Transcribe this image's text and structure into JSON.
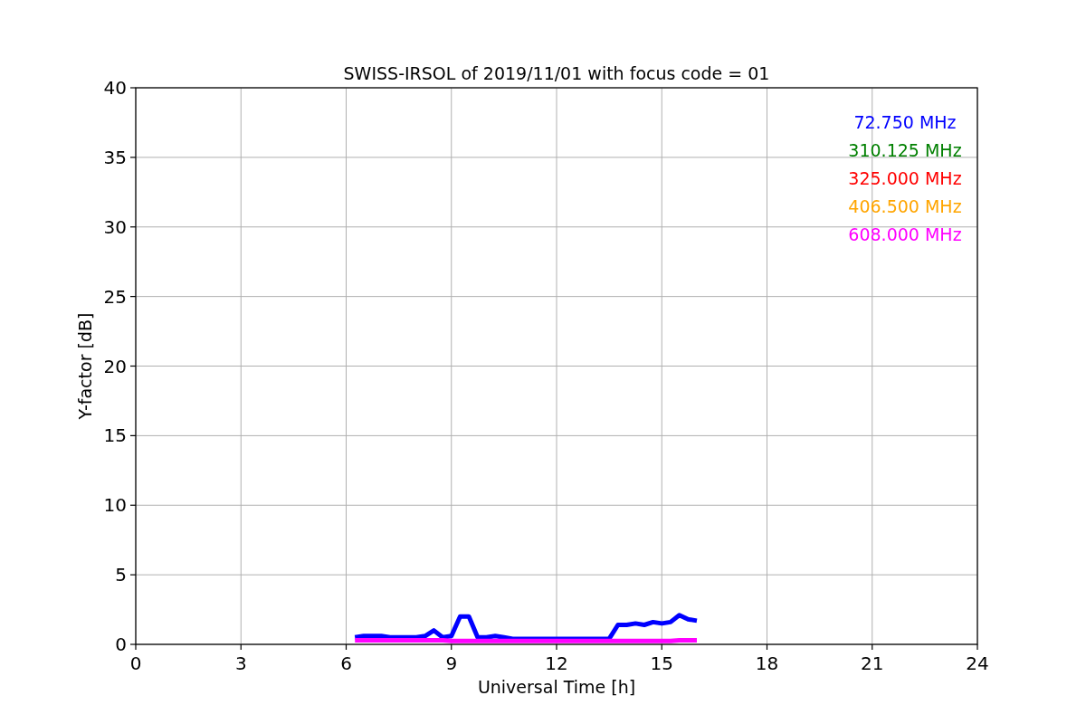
{
  "figure": {
    "chart_data": {
      "type": "line",
      "title": "SWISS-IRSOL of 2019/11/01 with focus code = 01",
      "xlabel": "Universal Time [h]",
      "ylabel": "Y-factor [dB]",
      "x": [
        6.25,
        6.5,
        6.75,
        7,
        7.25,
        7.5,
        7.75,
        8,
        8.25,
        8.5,
        8.75,
        9,
        9.25,
        9.5,
        9.75,
        10,
        10.25,
        10.5,
        10.75,
        11,
        11.25,
        11.5,
        11.75,
        12,
        12.25,
        12.5,
        12.75,
        13,
        13.25,
        13.5,
        13.75,
        14,
        14.25,
        14.5,
        14.75,
        15,
        15.25,
        15.5,
        15.75,
        16
      ],
      "series": [
        {
          "name": "72.750 MHz",
          "color": "#0000ff",
          "values": [
            0.5,
            0.6,
            0.6,
            0.6,
            0.5,
            0.5,
            0.5,
            0.5,
            0.6,
            1.0,
            0.5,
            0.6,
            2.0,
            2.0,
            0.5,
            0.5,
            0.6,
            0.5,
            0.4,
            0.4,
            0.4,
            0.4,
            0.4,
            0.4,
            0.4,
            0.4,
            0.4,
            0.4,
            0.4,
            0.4,
            1.4,
            1.4,
            1.5,
            1.4,
            1.6,
            1.5,
            1.6,
            2.1,
            1.8,
            1.7
          ]
        },
        {
          "name": "310.125 MHz",
          "color": "#008000",
          "values": [
            null,
            null,
            null,
            null,
            null,
            null,
            null,
            null,
            null,
            null,
            null,
            null,
            null,
            null,
            null,
            null,
            null,
            null,
            null,
            null,
            null,
            null,
            null,
            null,
            null,
            null,
            null,
            null,
            null,
            null,
            null,
            null,
            null,
            null,
            null,
            null,
            null,
            null,
            null,
            null
          ]
        },
        {
          "name": "325.000 MHz",
          "color": "#ff0000",
          "values": [
            null,
            null,
            null,
            null,
            null,
            null,
            null,
            null,
            null,
            null,
            null,
            null,
            null,
            null,
            null,
            null,
            null,
            null,
            null,
            null,
            null,
            null,
            null,
            null,
            null,
            null,
            null,
            null,
            null,
            null,
            null,
            null,
            null,
            null,
            null,
            null,
            null,
            null,
            null,
            null
          ]
        },
        {
          "name": "406.500 MHz",
          "color": "#ffa500",
          "values": [
            null,
            null,
            null,
            null,
            null,
            null,
            null,
            null,
            null,
            null,
            null,
            null,
            null,
            null,
            null,
            null,
            null,
            null,
            null,
            null,
            null,
            null,
            null,
            null,
            null,
            null,
            null,
            null,
            null,
            null,
            null,
            null,
            null,
            null,
            null,
            null,
            null,
            null,
            null,
            null
          ]
        },
        {
          "name": "608.000 MHz",
          "color": "#ff00ff",
          "values": [
            0.3,
            0.3,
            0.3,
            0.3,
            0.3,
            0.3,
            0.3,
            0.3,
            0.3,
            0.3,
            0.3,
            0.25,
            0.25,
            0.25,
            0.25,
            0.25,
            0.25,
            0.25,
            0.25,
            0.25,
            0.25,
            0.25,
            0.25,
            0.25,
            0.25,
            0.25,
            0.25,
            0.25,
            0.25,
            0.25,
            0.25,
            0.25,
            0.25,
            0.25,
            0.25,
            0.25,
            0.25,
            0.3,
            0.3,
            0.3
          ]
        }
      ],
      "grid": true,
      "xlim": [
        0,
        24
      ],
      "ylim": [
        0,
        40
      ],
      "xticks": [
        0,
        3,
        6,
        9,
        12,
        15,
        18,
        21,
        24
      ],
      "yticks": [
        0,
        5,
        10,
        15,
        20,
        25,
        30,
        35,
        40
      ]
    }
  }
}
